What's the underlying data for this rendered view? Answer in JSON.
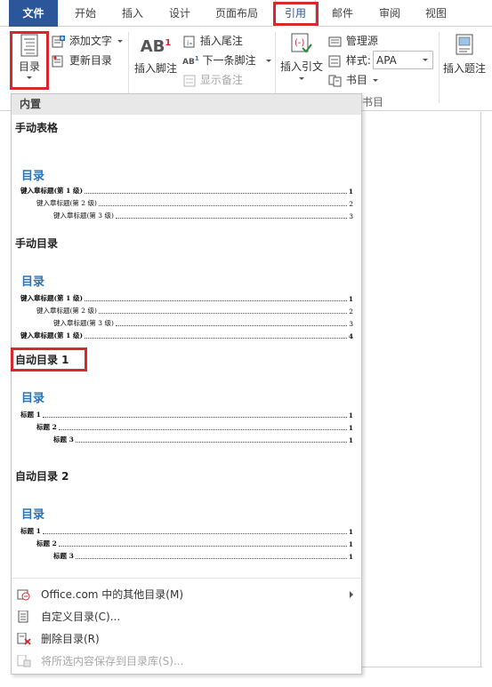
{
  "tabs": {
    "file": "文件",
    "home": "开始",
    "insert": "插入",
    "design": "设计",
    "layout": "页面布局",
    "references": "引用",
    "mailings": "邮件",
    "review": "审阅",
    "view": "视图"
  },
  "ribbon": {
    "toc_label": "目录",
    "add_text": "添加文字",
    "update_toc": "更新目录",
    "insert_footnote": "插入脚注",
    "insert_endnote": "插入尾注",
    "next_footnote": "下一条脚注",
    "show_notes": "显示备注",
    "insert_citation": "插入引文",
    "manage_sources": "管理源",
    "style_label": "样式:",
    "style_value": "APA",
    "bibliography": "书目",
    "citations_group_label": "书目",
    "insert_caption": "插入题注",
    "footnote_badge": "AB",
    "footnote_sup": "1",
    "next_fn_badge": "AB",
    "next_fn_sup": "1"
  },
  "panel": {
    "header": "内置",
    "galleries": [
      {
        "title": "手动表格",
        "heading": "目录",
        "rows": [
          {
            "text": "键入章标题(第 1 级)",
            "page": "1"
          },
          {
            "text": "键入章标题(第 2 级)",
            "page": "2"
          },
          {
            "text": "键入章标题(第 3 级)",
            "page": "3"
          }
        ]
      },
      {
        "title": "手动目录",
        "heading": "目录",
        "rows": [
          {
            "text": "键入章标题(第 1 级)",
            "page": "1"
          },
          {
            "text": "键入章标题(第 2 级)",
            "page": "2"
          },
          {
            "text": "键入章标题(第 3 级)",
            "page": "3"
          },
          {
            "text": "键入章标题(第 1 级)",
            "page": "4"
          }
        ]
      },
      {
        "title": "自动目录 1",
        "heading": "目录",
        "rows": [
          {
            "text": "标题 1",
            "page": "1"
          },
          {
            "text": "标题 2",
            "page": "1"
          },
          {
            "text": "标题 3",
            "page": "1"
          }
        ]
      },
      {
        "title": "自动目录 2",
        "heading": "目录",
        "rows": [
          {
            "text": "标题 1",
            "page": "1"
          },
          {
            "text": "标题 2",
            "page": "1"
          },
          {
            "text": "标题 3",
            "page": "1"
          }
        ]
      }
    ],
    "menu": {
      "more_toc": "Office.com 中的其他目录(M)",
      "custom_toc": "自定义目录(C)...",
      "remove_toc": "删除目录(R)",
      "save_selection": "将所选内容保存到目录库(S)..."
    }
  },
  "colors": {
    "file_tab": "#2b579a",
    "highlight": "#d9272e",
    "toc_heading": "#2e74b5"
  }
}
